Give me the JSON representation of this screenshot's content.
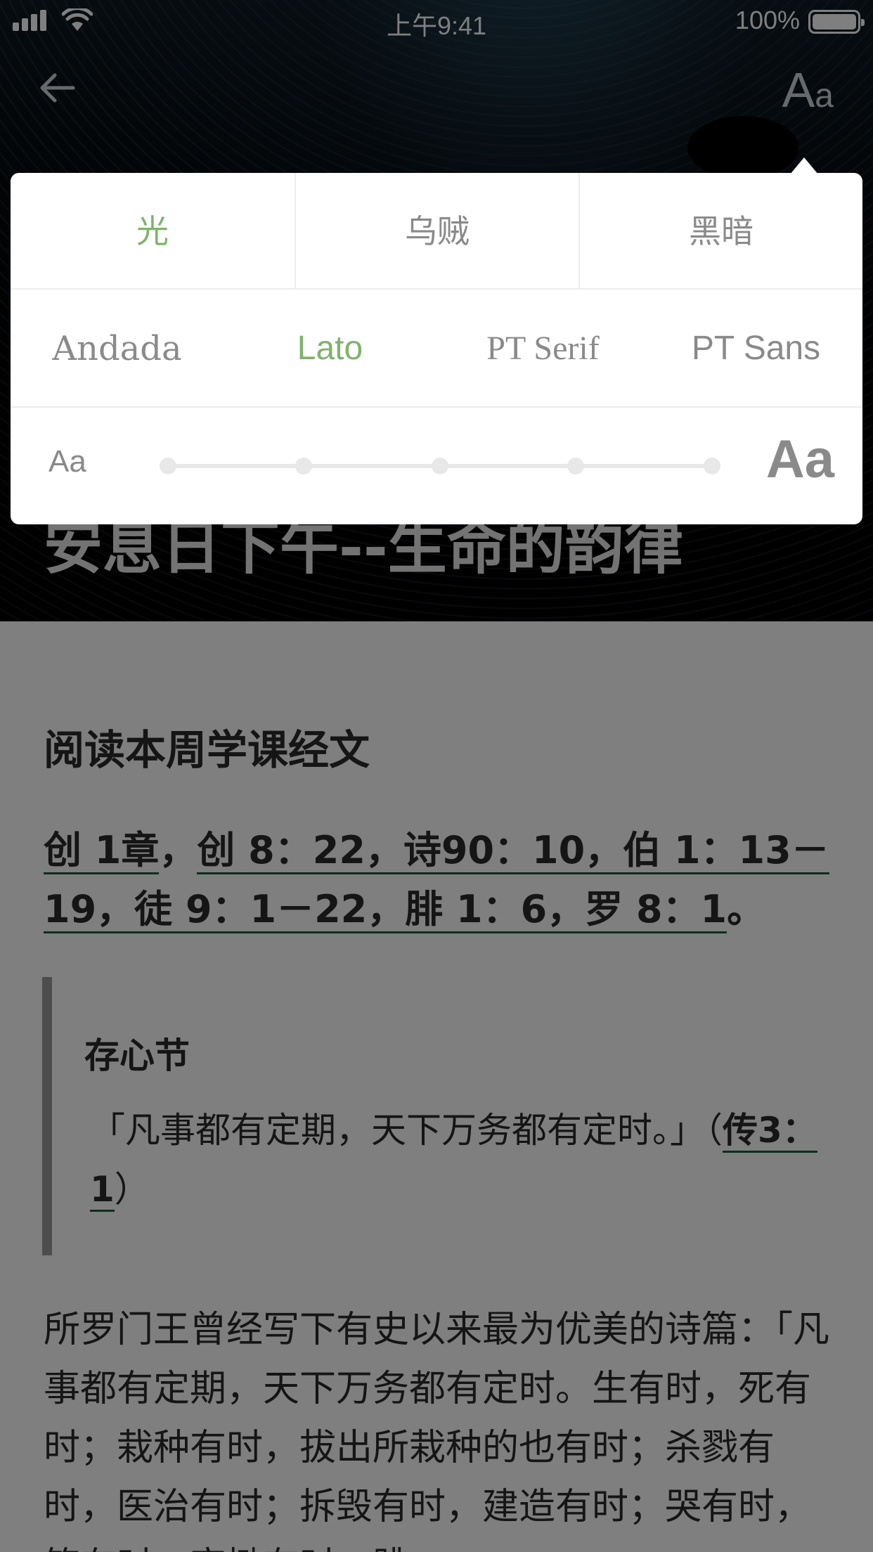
{
  "status_bar": {
    "time": "上午9:41",
    "battery": "100%"
  },
  "nav": {
    "font_button": {
      "big": "A",
      "small": "a"
    }
  },
  "hero": {
    "title": "安息日下午--生命的韵律"
  },
  "settings": {
    "themes": [
      {
        "label": "光",
        "active": true
      },
      {
        "label": "乌贼",
        "active": false
      },
      {
        "label": "黑暗",
        "active": false
      }
    ],
    "fonts": [
      {
        "label": "Andada",
        "active": false
      },
      {
        "label": "Lato",
        "active": true
      },
      {
        "label": "PT Serif",
        "active": false
      },
      {
        "label": "PT Sans",
        "active": false
      }
    ],
    "size": {
      "small_label": "Aa",
      "large_label": "Aa",
      "steps": 5
    },
    "accent_color": "#7fb36a"
  },
  "content": {
    "heading": "阅读本周学课经文",
    "references": {
      "ref1": "创 1章",
      "sep1": "，",
      "ref2": "创 8：22，诗90：10，伯 1：13－19，徒 9：1－22，腓 1：6，罗 8：1",
      "end": "。"
    },
    "memory_verse": {
      "title": "存心节",
      "text": "「凡事都有定期，天下万务都有定时。」（",
      "ref": "传3：1",
      "close": "）"
    },
    "paragraph": "所罗门王曾经写下有史以来最为优美的诗篇：「凡事都有定期，天下万务都有定时。生有时，死有时；栽种有时，拔出所栽种的也有时；杀戮有时，医治有时；拆毁有时，建造有时；哭有时，笑有时；哀恸有时，跳"
  }
}
